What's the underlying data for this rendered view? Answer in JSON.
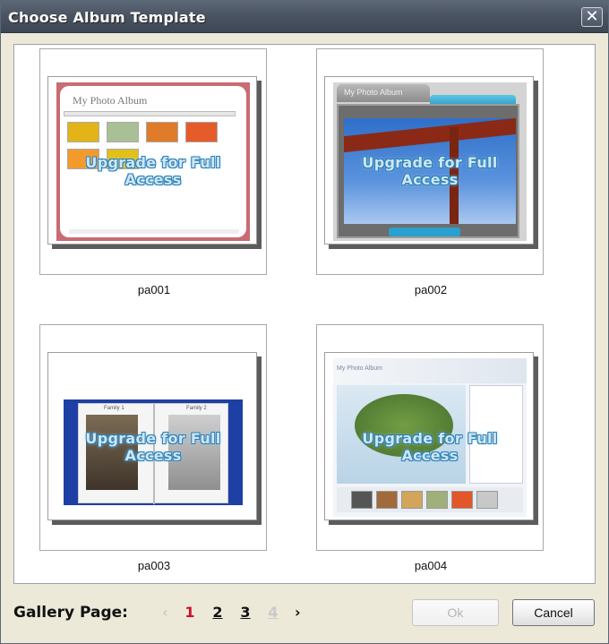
{
  "window": {
    "title": "Choose Album Template"
  },
  "templates": [
    {
      "id": "pa001",
      "label": "pa001",
      "preview_title": "My Photo Album"
    },
    {
      "id": "pa002",
      "label": "pa002",
      "preview_title": "My Photo Album"
    },
    {
      "id": "pa003",
      "label": "pa003",
      "left_caption": "Family 1",
      "right_caption": "Family 2"
    },
    {
      "id": "pa004",
      "label": "pa004",
      "preview_title": "My Photo Album"
    }
  ],
  "watermark": "Upgrade for Full Access",
  "footer": {
    "gallery_label": "Gallery Page:",
    "prev_arrow": "‹",
    "next_arrow": "›",
    "pages": [
      "1",
      "2",
      "3",
      "4"
    ],
    "current_page": "1",
    "ok_label": "Ok",
    "cancel_label": "Cancel"
  },
  "icons": {
    "close": "close-icon",
    "prev": "chevron-left-icon",
    "next": "chevron-right-icon"
  }
}
